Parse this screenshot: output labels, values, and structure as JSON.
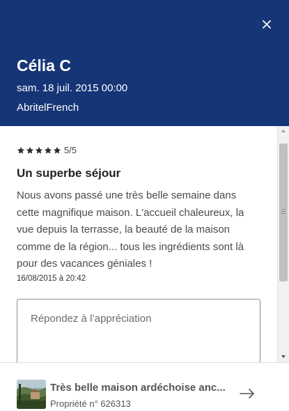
{
  "header": {
    "reviewer_name": "Célia C",
    "date": "sam. 18 juil. 2015 00:00",
    "source": "AbritelFrench",
    "close_icon": "close-icon"
  },
  "review": {
    "rating_value": 5,
    "rating_max": 5,
    "rating_text": "5/5",
    "title": "Un superbe séjour",
    "body": "Nous avons passé une très belle semaine dans cette magnifique maison. L'accueil chaleureux, la vue depuis la terrasse, la beauté de la maison comme de la région... tous les ingrédients sont là pour des vacances géniales !",
    "posted": "16/08/2015 à 20:42"
  },
  "reply": {
    "placeholder": "Répondez à l’appréciation",
    "value": ""
  },
  "property": {
    "name": "Très belle maison ardéchoise anc...",
    "id_text": "Propriété n° 626313",
    "arrow_icon": "arrow-right-icon"
  },
  "colors": {
    "header_bg": "#163576",
    "text": "#4a4a4a"
  }
}
